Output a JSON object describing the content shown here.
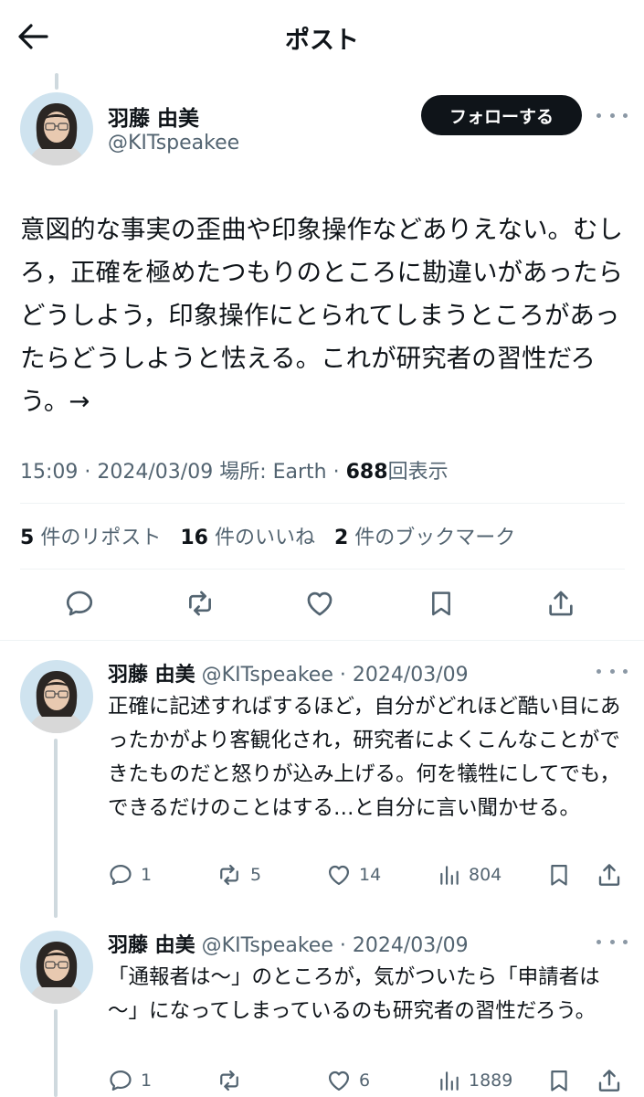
{
  "header": {
    "title": "ポスト"
  },
  "post": {
    "author_name": "羽藤 由美",
    "author_handle": "@KITspeakee",
    "follow_label": "フォローする",
    "text": "意図的な事実の歪曲や印象操作などありえない。むしろ，正確を極めたつもりのところに勘違いがあったらどうしよう，印象操作にとられてしまうところがあったらどうしようと怯える。これが研究者の習性だろう。→",
    "time": "15:09",
    "date": "2024/03/09",
    "location": "場所: Earth",
    "views": "688",
    "views_label": "回表示",
    "reposts": "5",
    "reposts_label": "件のリポスト",
    "likes": "16",
    "likes_label": "件のいいね",
    "bookmarks": "2",
    "bookmarks_label": "件のブックマーク"
  },
  "replies": [
    {
      "author_name": "羽藤 由美",
      "author_handle": "@KITspeakee",
      "date": "2024/03/09",
      "text": "正確に記述すればするほど，自分がどれほど酷い目にあったかがより客観化され，研究者によくこんなことができたものだと怒りが込み上げる。何を犠牲にしてでも，できるだけのことはする…と自分に言い聞かせる。",
      "replies": "1",
      "reposts": "5",
      "likes": "14",
      "views": "804"
    },
    {
      "author_name": "羽藤 由美",
      "author_handle": "@KITspeakee",
      "date": "2024/03/09",
      "text": "「通報者は～」のところが，気がついたら「申請者は～」になってしまっているのも研究者の習性だろう。",
      "replies": "1",
      "reposts": "",
      "likes": "6",
      "views": "1889"
    }
  ],
  "separator": "·",
  "icons": {
    "back": "back-arrow-icon",
    "more": "more-icon",
    "reply": "reply-icon",
    "repost": "repost-icon",
    "like": "heart-icon",
    "bookmark": "bookmark-icon",
    "share": "share-icon",
    "views": "views-icon"
  },
  "colors": {
    "text": "#0f1419",
    "secondary": "#536471",
    "divider": "#eff3f4",
    "thread": "#cfd9de",
    "follow_bg": "#0f1419"
  }
}
